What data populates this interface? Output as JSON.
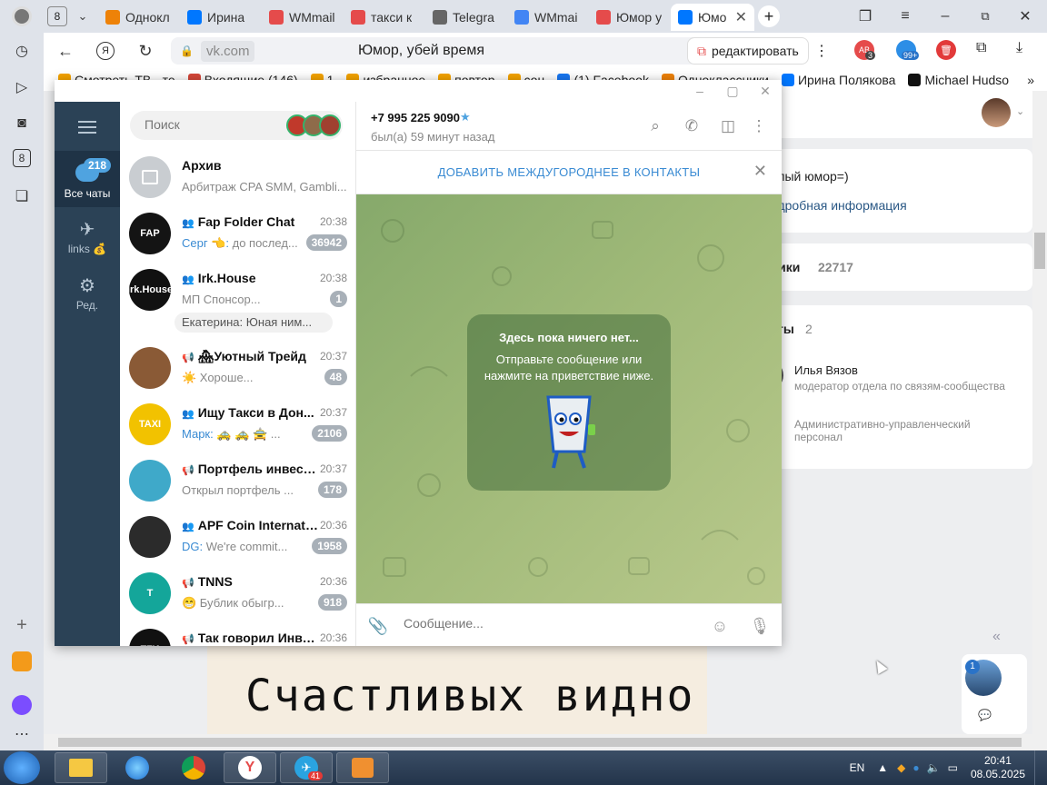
{
  "browser": {
    "tab_counter": "8",
    "tabs": [
      {
        "label": "Однокл",
        "icon": "odnoklassniki-icon",
        "color": "#ee8208",
        "active": false
      },
      {
        "label": "Ирина",
        "icon": "vk-icon",
        "color": "#0077ff",
        "active": false
      },
      {
        "label": "WMmail",
        "icon": "yandex-icon",
        "color": "#e54b4b",
        "active": false
      },
      {
        "label": "такси к",
        "icon": "yandex-icon",
        "color": "#e54b4b",
        "active": false
      },
      {
        "label": "Telegra",
        "icon": "document-icon",
        "color": "#666666",
        "active": false
      },
      {
        "label": "WMmai",
        "icon": "google-icon",
        "color": "#4285f4",
        "active": false
      },
      {
        "label": "Юмор у",
        "icon": "yandex-icon",
        "color": "#e54b4b",
        "active": false
      },
      {
        "label": "Юмо",
        "icon": "vk-icon",
        "color": "#0077ff",
        "active": true
      }
    ],
    "url_domain": "vk.com",
    "page_title": "Юмор, убей время",
    "edit_label": "редактировать",
    "ext_badges": [
      "3",
      "99+"
    ],
    "bookmarks": [
      {
        "label": "Смотреть ТВ - те",
        "color": "#f4a300"
      },
      {
        "label": "Входящие (146)",
        "color": "#d44638"
      },
      {
        "label": "1",
        "color": "#f4a300"
      },
      {
        "label": "избранное",
        "color": "#f4a300"
      },
      {
        "label": "повтор",
        "color": "#f4a300"
      },
      {
        "label": "соц",
        "color": "#f4a300"
      },
      {
        "label": "(1) Facebook",
        "color": "#1877f2"
      },
      {
        "label": "Одноклассники",
        "color": "#ee8208"
      },
      {
        "label": "Ирина Полякова",
        "color": "#0077ff"
      },
      {
        "label": "Michael Hudso",
        "color": "#111111"
      }
    ]
  },
  "vk": {
    "about_text": "елый юмор=)",
    "more_info": "одробная информация",
    "subscribers_label": "чики",
    "subscribers_count": "22717",
    "contacts_label": "кты",
    "contacts_count": "2",
    "contact1_name": "Илья Вязов",
    "contact1_role": "модератор отдела по связям-сообщества",
    "contact2_role1": "Административно-управленческий",
    "contact2_role2": "персонал",
    "banner_text": "Счастливых видно",
    "chat_bubble_badge": "1"
  },
  "telegram": {
    "rail": {
      "all_chats": "Все чаты",
      "all_chats_badge": "218",
      "links": "links",
      "edit": "Ред."
    },
    "search_placeholder": "Поиск",
    "chats": [
      {
        "name": "Архив",
        "time": "",
        "preview": "Арбитраж CPA SMM, Gambli...",
        "badge": "",
        "kind": "archive",
        "avatar_color": "#c9cdd1",
        "avatar_text": ""
      },
      {
        "name": "Fap Folder Chat",
        "time": "20:38",
        "sender": "Серг 👈:",
        "preview": " до послед...",
        "badge": "36942",
        "kind": "group",
        "avatar_color": "#141414",
        "avatar_text": "FAP"
      },
      {
        "name": "Irk.House",
        "time": "20:38",
        "sender": "",
        "preview": "МП  Спонсор...",
        "badge": "1",
        "kind": "group",
        "avatar_color": "#111111",
        "avatar_text": "Irk.House",
        "extra": "Екатерина: Юная ним..."
      },
      {
        "name": "🏘Уютный Трейд",
        "time": "20:37",
        "sender": "",
        "preview": "☀️ Хороше...",
        "badge": "48",
        "kind": "channel",
        "avatar_color": "#8a5a36",
        "avatar_text": ""
      },
      {
        "name": "Ищу Такси в Дон...",
        "time": "20:37",
        "sender": "Марк:",
        "preview": " 🚕 🚕 🚖 ...",
        "badge": "2106",
        "kind": "group",
        "avatar_color": "#f2c200",
        "avatar_text": "TAXI"
      },
      {
        "name": "Портфель инвест...",
        "time": "20:37",
        "sender": "",
        "preview": "Открыл портфель ...",
        "badge": "178",
        "kind": "channel",
        "avatar_color": "#3fa9c9",
        "avatar_text": ""
      },
      {
        "name": "APF Coin Internati...",
        "time": "20:36",
        "sender": "DG:",
        "preview": " We're commit...",
        "badge": "1958",
        "kind": "group",
        "avatar_color": "#2b2b2b",
        "avatar_text": ""
      },
      {
        "name": "TNNS",
        "time": "20:36",
        "sender": "",
        "preview": "😁 Бублик обыгр...",
        "badge": "918",
        "kind": "channel",
        "avatar_color": "#14a69a",
        "avatar_text": "T"
      },
      {
        "name": "Так говорил Инве...",
        "time": "20:36",
        "sender": "",
        "preview": "",
        "badge": "",
        "kind": "channel",
        "avatar_color": "#111111",
        "avatar_text": "ТГИ"
      }
    ],
    "chat": {
      "phone": "+7 995 225 9090",
      "status": "был(а) 59 минут назад",
      "add_contact": "ДОБАВИТЬ МЕЖДУГОРОДНЕЕ В КОНТАКТЫ",
      "empty_title": "Здесь пока ничего нет...",
      "empty_text": "Отправьте сообщение или нажмите на приветствие ниже.",
      "compose_placeholder": "Сообщение..."
    }
  },
  "taskbar": {
    "lang": "EN",
    "time": "20:41",
    "date": "08.05.2025",
    "telegram_badge": "41"
  }
}
